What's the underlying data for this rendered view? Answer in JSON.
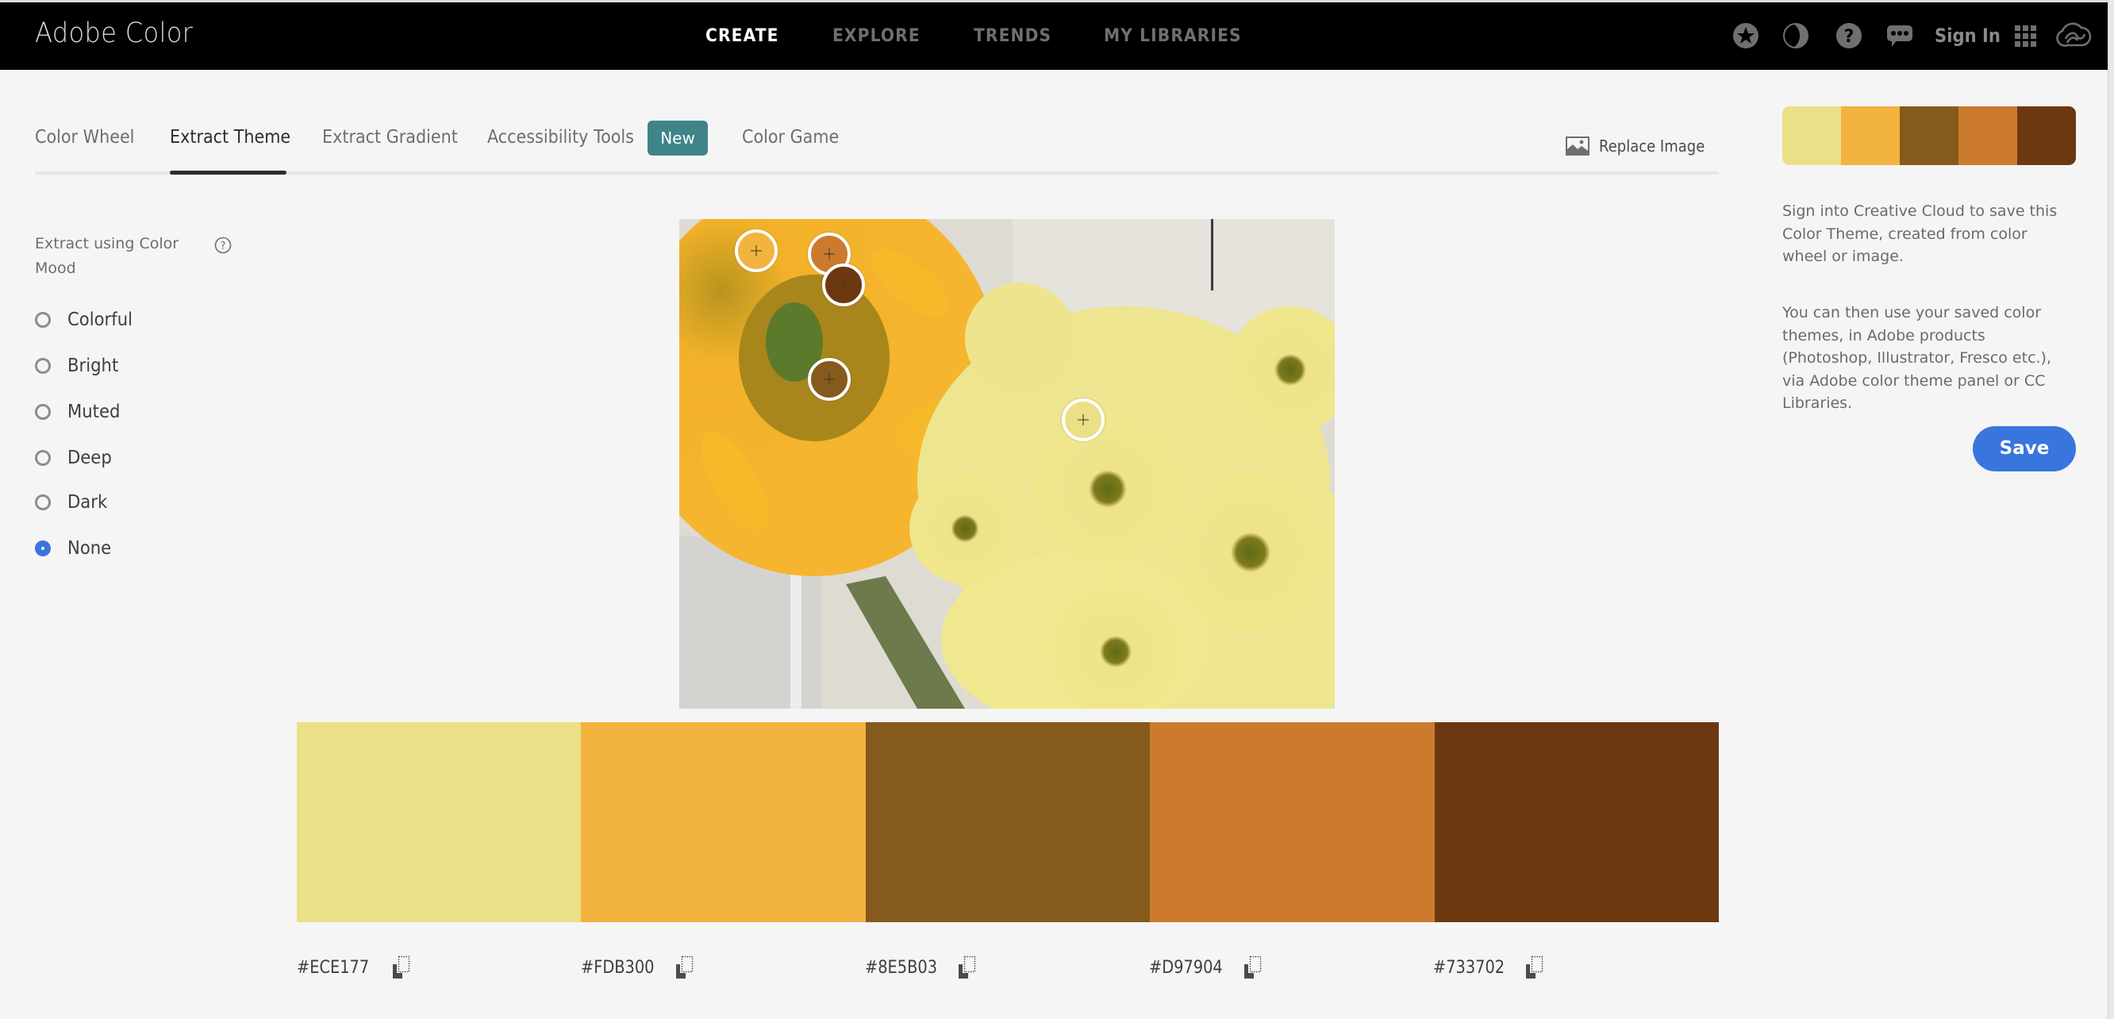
{
  "app": {
    "title": "Adobe Color"
  },
  "topnav": {
    "items": [
      {
        "label": "CREATE",
        "active": true
      },
      {
        "label": "EXPLORE",
        "active": false
      },
      {
        "label": "TRENDS",
        "active": false
      },
      {
        "label": "MY LIBRARIES",
        "active": false
      }
    ],
    "icons": [
      "star-circle-icon",
      "moon-contrast-icon",
      "help-question-icon",
      "chat-bubble-icon"
    ],
    "sign_in_label": "Sign In",
    "apps_icon": "apps-grid-icon",
    "cc_icon": "creative-cloud-icon"
  },
  "tabs": {
    "items": [
      {
        "label": "Color Wheel",
        "active": false
      },
      {
        "label": "Extract Theme",
        "active": true
      },
      {
        "label": "Extract Gradient",
        "active": false
      },
      {
        "label": "Accessibility Tools",
        "active": false
      },
      {
        "label": "Color Game",
        "active": false
      }
    ],
    "new_badge": "New",
    "replace_image_label": "Replace Image"
  },
  "sidebar": {
    "title": "Extract using Color Mood",
    "help_icon": "help-circle-icon",
    "options": [
      {
        "label": "Colorful",
        "checked": false
      },
      {
        "label": "Bright",
        "checked": false
      },
      {
        "label": "Muted",
        "checked": false
      },
      {
        "label": "Deep",
        "checked": false
      },
      {
        "label": "Dark",
        "checked": false
      },
      {
        "label": "None",
        "checked": true
      }
    ]
  },
  "theme": {
    "swatches": [
      {
        "hex": "#ECE177",
        "display": "#ECE177"
      },
      {
        "hex": "#FDB300",
        "display": "#FDB300",
        "render": "#F2B33F"
      },
      {
        "hex": "#8E5B03",
        "display": "#8E5B03",
        "render": "#865A1D"
      },
      {
        "hex": "#D97904",
        "display": "#D97904",
        "render": "#CC7B2E"
      },
      {
        "hex": "#733702",
        "display": "#733702",
        "render": "#6C3812"
      }
    ],
    "render_colors": [
      "#EBDF87",
      "#F2B33F",
      "#865A1D",
      "#CC7B2E",
      "#6C3812"
    ]
  },
  "right_panel": {
    "info_1": "Sign into Creative Cloud to save this Color Theme, created from color wheel or image.",
    "info_2": "You can then use your saved color themes, in Adobe products (Photoshop, Illustrator, Fresco etc.), via Adobe color theme panel or CC Libraries.",
    "save_label": "Save"
  }
}
